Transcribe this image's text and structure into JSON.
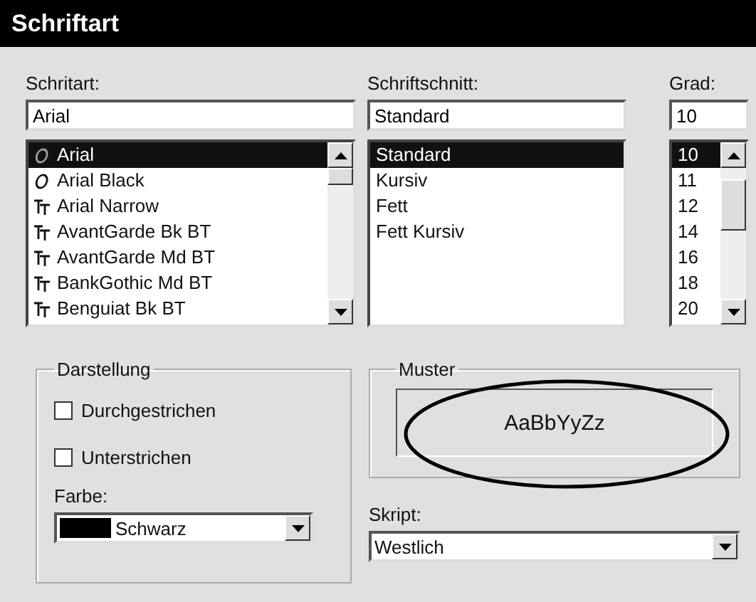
{
  "window": {
    "title": "Schriftart"
  },
  "font": {
    "label": "Schritart:",
    "value": "Arial",
    "items": [
      {
        "label": "Arial",
        "kind": "opentype",
        "selected": true
      },
      {
        "label": "Arial Black",
        "kind": "opentype",
        "selected": false
      },
      {
        "label": "Arial Narrow",
        "kind": "truetype",
        "selected": false
      },
      {
        "label": "AvantGarde Bk BT",
        "kind": "truetype",
        "selected": false
      },
      {
        "label": "AvantGarde Md BT",
        "kind": "truetype",
        "selected": false
      },
      {
        "label": "BankGothic Md BT",
        "kind": "truetype",
        "selected": false
      },
      {
        "label": "Benguiat Bk BT",
        "kind": "truetype",
        "selected": false
      }
    ]
  },
  "style": {
    "label": "Schriftschnitt:",
    "value": "Standard",
    "items": [
      {
        "label": "Standard",
        "selected": true
      },
      {
        "label": "Kursiv",
        "selected": false
      },
      {
        "label": "Fett",
        "selected": false
      },
      {
        "label": "Fett Kursiv",
        "selected": false
      }
    ]
  },
  "size": {
    "label": "Grad:",
    "value": "10",
    "items": [
      {
        "label": "10",
        "selected": true
      },
      {
        "label": "11",
        "selected": false
      },
      {
        "label": "12",
        "selected": false
      },
      {
        "label": "14",
        "selected": false
      },
      {
        "label": "16",
        "selected": false
      },
      {
        "label": "18",
        "selected": false
      },
      {
        "label": "20",
        "selected": false
      }
    ]
  },
  "effects": {
    "title": "Darstellung",
    "options": [
      {
        "label": "Durchgestrichen",
        "checked": false
      },
      {
        "label": "Unterstrichen",
        "checked": false
      }
    ],
    "color_label": "Farbe:",
    "color": {
      "label": "Schwarz",
      "color": "#000000"
    }
  },
  "sample": {
    "title": "Muster",
    "text": "AaBbYyZz",
    "annotated": true
  },
  "script": {
    "label": "Skript:",
    "value": "Westlich"
  }
}
